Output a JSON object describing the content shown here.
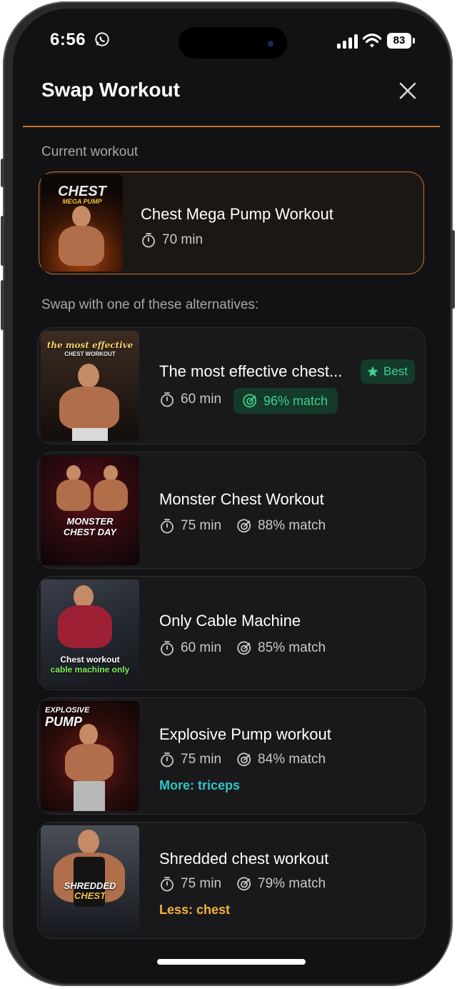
{
  "status_bar": {
    "time": "6:56",
    "battery": "83"
  },
  "header": {
    "title": "Swap Workout"
  },
  "current_section_label": "Current workout",
  "current": {
    "title": "Chest Mega Pump Workout",
    "duration": "70 min",
    "thumb_line1": "CHEST",
    "thumb_line2": "MEGA PUMP"
  },
  "alternatives_label": "Swap with one of these alternatives:",
  "alternatives": [
    {
      "title": "The most effective chest...",
      "duration": "60 min",
      "match": "96% match",
      "badge": "Best",
      "thumb_line1": "the most effective",
      "thumb_line2": "CHEST WORKOUT"
    },
    {
      "title": "Monster Chest Workout",
      "duration": "75 min",
      "match": "88% match",
      "thumb_line1": "MONSTER",
      "thumb_line2": "CHEST DAY"
    },
    {
      "title": "Only Cable Machine",
      "duration": "60 min",
      "match": "85% match",
      "thumb_line1": "Chest workout",
      "thumb_line2": "cable machine only"
    },
    {
      "title": "Explosive Pump workout",
      "duration": "75 min",
      "match": "84% match",
      "note": "More: triceps",
      "thumb_line1": "EXPLOSIVE",
      "thumb_line2": "PUMP"
    },
    {
      "title": "Shredded chest workout",
      "duration": "75 min",
      "match": "79% match",
      "note": "Less: chest",
      "thumb_line1": "SHREDDED",
      "thumb_line2": "CHEST"
    }
  ],
  "colors": {
    "accent_orange": "#c9762a",
    "match_green": "#3ecf8e",
    "note_teal": "#2ec4c4",
    "note_amber": "#f2b23a"
  },
  "icons": {
    "close": "close-icon",
    "timer": "stopwatch-icon",
    "match": "target-icon",
    "best": "star-icon"
  }
}
